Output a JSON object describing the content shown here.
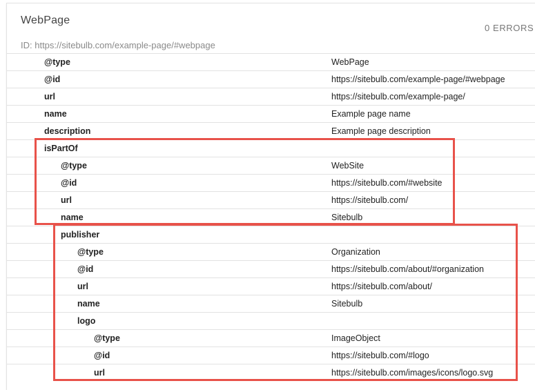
{
  "card": {
    "title": "WebPage",
    "errors": "0 ERRORS",
    "id_line": "ID: https://sitebulb.com/example-page/#webpage"
  },
  "rows": [
    {
      "key": "@type",
      "value": "WebPage"
    },
    {
      "key": "@id",
      "value": "https://sitebulb.com/example-page/#webpage"
    },
    {
      "key": "url",
      "value": "https://sitebulb.com/example-page/"
    },
    {
      "key": "name",
      "value": "Example page name"
    },
    {
      "key": "description",
      "value": "Example page description"
    },
    {
      "key": "isPartOf",
      "value": ""
    },
    {
      "key": "@type",
      "value": "WebSite"
    },
    {
      "key": "@id",
      "value": "https://sitebulb.com/#website"
    },
    {
      "key": "url",
      "value": "https://sitebulb.com/"
    },
    {
      "key": "name",
      "value": "Sitebulb"
    },
    {
      "key": "publisher",
      "value": ""
    },
    {
      "key": "@type",
      "value": "Organization"
    },
    {
      "key": "@id",
      "value": "https://sitebulb.com/about/#organization"
    },
    {
      "key": "url",
      "value": "https://sitebulb.com/about/"
    },
    {
      "key": "name",
      "value": "Sitebulb"
    },
    {
      "key": "logo",
      "value": ""
    },
    {
      "key": "@type",
      "value": "ImageObject"
    },
    {
      "key": "@id",
      "value": "https://sitebulb.com/#logo"
    },
    {
      "key": "url",
      "value": "https://sitebulb.com/images/icons/logo.svg"
    }
  ],
  "highlight_color": "#e8524a"
}
